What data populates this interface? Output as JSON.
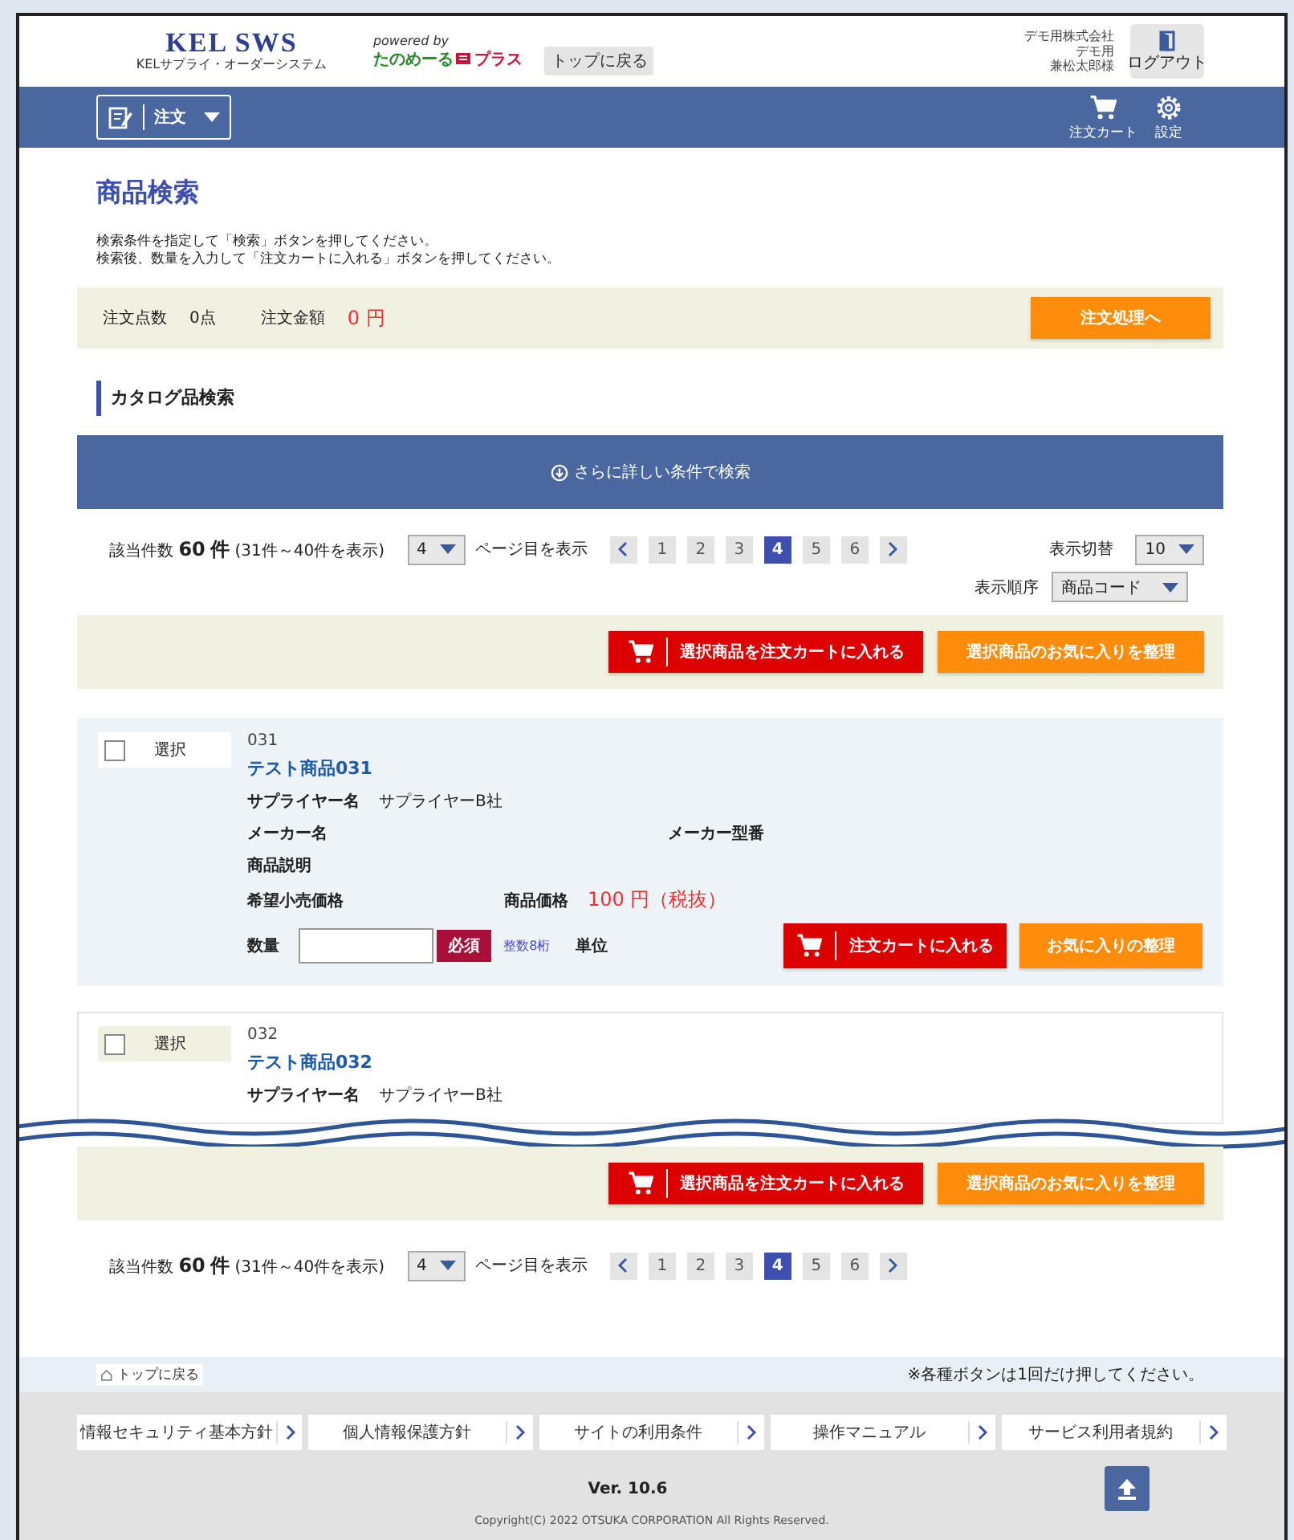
{
  "header": {
    "logo_title": "KEL SWS",
    "logo_subtitle": "KELサプライ・オーダーシステム",
    "powered_by": "powered by",
    "partner_logo": "たのめーる",
    "partner_logo_suffix": "プラス",
    "top_button": "トップに戻る",
    "company": "デモ用株式会社",
    "department": "デモ用",
    "user": "兼松太郎様",
    "logout": "ログアウト"
  },
  "navbar": {
    "menu": "注文",
    "cart": "注文カート",
    "settings": "設定"
  },
  "page_title": "商品検索",
  "instructions": [
    "検索条件を指定して「検索」ボタンを押してください。",
    "検索後、数量を入力して「注文カートに入れる」ボタンを押してください。"
  ],
  "order_summary": {
    "count_label": "注文点数",
    "count": "0点",
    "amount_label": "注文金額",
    "amount": "0 円",
    "proceed_button": "注文処理へ"
  },
  "section_title": "カタログ品検索",
  "advanced_search": "さらに詳しい条件で検索",
  "pager_top": {
    "count_label": "該当件数",
    "count": "60",
    "count_unit": "件",
    "range": "(31件～40件を表示)",
    "page_select": "4",
    "page_label": "ページ目を表示",
    "pages": [
      {
        "label": "1",
        "selected": false
      },
      {
        "label": "2",
        "selected": false
      },
      {
        "label": "3",
        "selected": false
      },
      {
        "label": "4",
        "selected": true
      },
      {
        "label": "5",
        "selected": false
      },
      {
        "label": "6",
        "selected": false
      }
    ],
    "per_page_label": "表示切替",
    "per_page": "10"
  },
  "sort": {
    "label": "表示順序",
    "value": "商品コード"
  },
  "bulk_actions_top": {
    "add_to_cart": "選択商品を注文カートに入れる",
    "favorites": "選択商品のお気に入りを整理"
  },
  "products": [
    {
      "select_label": "選択",
      "checked": false,
      "highlighted": true,
      "code": "031",
      "name": "テスト商品031",
      "supplier_label": "サプライヤー名",
      "supplier": "サプライヤーB社",
      "maker_label": "メーカー名",
      "model_label": "メーカー型番",
      "description_label": "商品説明",
      "retail_price_label": "希望小売価格",
      "price_label": "商品価格",
      "price": "100 円（税抜）",
      "quantity_label": "数量",
      "required": "必須",
      "hint": "整数8桁",
      "unit_label": "単位",
      "cart_button": "注文カートに入れる",
      "favorite_button": "お気に入りの整理"
    },
    {
      "select_label": "選択",
      "checked": false,
      "highlighted": false,
      "code": "032",
      "name": "テスト商品032",
      "supplier_label": "サプライヤー名",
      "supplier": "サプライヤーB社"
    }
  ],
  "bulk_actions_bottom": {
    "add_to_cart": "選択商品を注文カートに入れる",
    "favorites": "選択商品のお気に入りを整理"
  },
  "pager_bottom": {
    "count_label": "該当件数",
    "count": "60",
    "count_unit": "件",
    "range": "(31件～40件を表示)",
    "page_select": "4",
    "page_label": "ページ目を表示",
    "pages": [
      {
        "label": "1",
        "selected": false
      },
      {
        "label": "2",
        "selected": false
      },
      {
        "label": "3",
        "selected": false
      },
      {
        "label": "4",
        "selected": true
      },
      {
        "label": "5",
        "selected": false
      },
      {
        "label": "6",
        "selected": false
      }
    ]
  },
  "footer": {
    "top_link": "トップに戻る",
    "note": "※各種ボタンは1回だけ押してください。",
    "links": [
      "情報セキュリティ基本方針",
      "個人情報保護方針",
      "サイトの利用条件",
      "操作マニュアル",
      "サービス利用者規約"
    ],
    "version": "Ver. 10.6",
    "copyright": "Copyright(C) 2022 OTSUKA CORPORATION All Rights Reserved."
  }
}
